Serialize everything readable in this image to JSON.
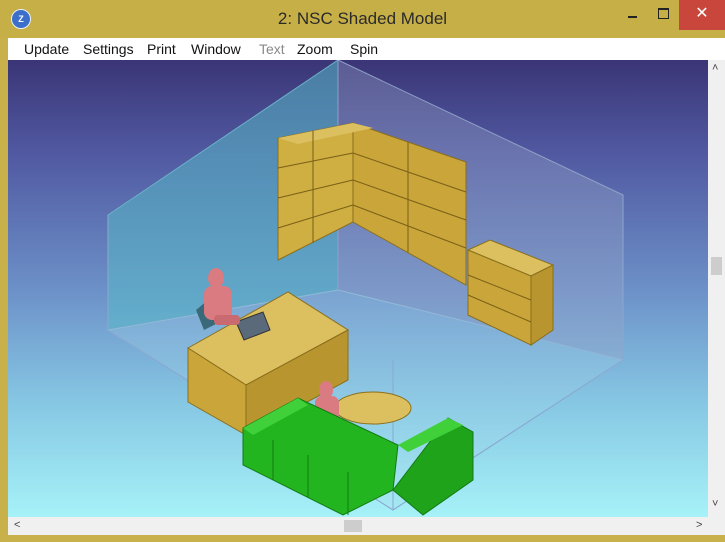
{
  "window": {
    "title": "2: NSC Shaded Model",
    "app_icon": "app-logo-icon",
    "controls": {
      "minimize": "minimize-icon",
      "maximize": "maximize-icon",
      "close": "close-icon",
      "close_glyph": "✕"
    },
    "colors": {
      "frame": "#c8b04a",
      "close": "#c9463d"
    }
  },
  "menu": {
    "items": [
      {
        "label": "Update",
        "enabled": true
      },
      {
        "label": "Settings",
        "enabled": true
      },
      {
        "label": "Print",
        "enabled": true
      },
      {
        "label": "Window",
        "enabled": true
      },
      {
        "label": "Text",
        "enabled": false
      },
      {
        "label": "Zoom",
        "enabled": true
      },
      {
        "label": "Spin",
        "enabled": true
      }
    ]
  },
  "viewport": {
    "scene": "shaded-3d-office-model",
    "colors": {
      "sky_top": "#3a3576",
      "sky_bottom": "#a6f2f8",
      "furniture": "#c9a53a",
      "sofa": "#22b51f",
      "figures": "#d97b80"
    }
  },
  "scrollbars": {
    "vertical": {
      "up_glyph": "˄",
      "down_glyph": "˅"
    },
    "horizontal": {
      "left_glyph": "<",
      "right_glyph": ">"
    }
  }
}
